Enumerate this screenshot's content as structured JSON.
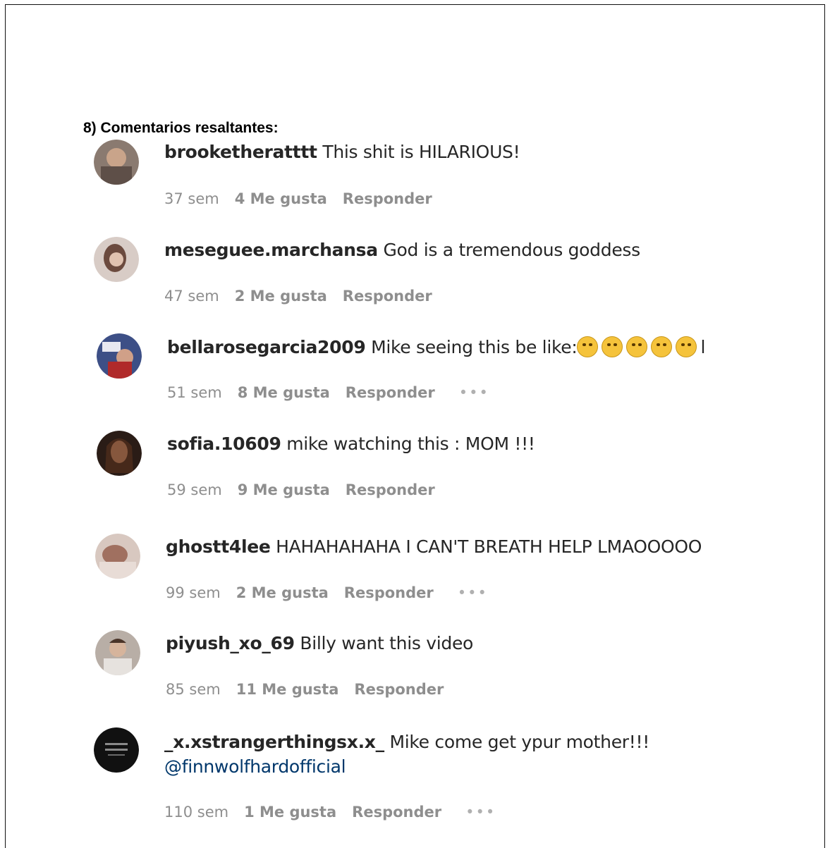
{
  "heading": "8) Comentarios resaltantes:",
  "labels": {
    "likes_suffix": "Me gusta",
    "reply": "Responder",
    "more": "•••"
  },
  "comments": [
    {
      "user": "brooketheratttt",
      "text": " This shit is HILARIOUS!",
      "time": "37 sem",
      "likes": "4 Me gusta",
      "more": false,
      "avatar_color": "#8a7a70"
    },
    {
      "user": "meseguee.marchansa",
      "text": " God is a tremendous goddess",
      "time": "47 sem",
      "likes": "2 Me gusta",
      "more": false,
      "avatar_color": "#a89890"
    },
    {
      "user": "bellarosegarcia2009",
      "text": " Mike seeing this be like:",
      "emojis": [
        "emoji-1",
        "emoji-2",
        "emoji-3",
        "emoji-4",
        "emoji-5"
      ],
      "text_after": "l",
      "time": "51 sem",
      "likes": "8 Me gusta",
      "more": true,
      "avatar_color": "#4a5a8a"
    },
    {
      "user": "sofia.10609",
      "text": " mike watching this : MOM !!!",
      "time": "59 sem",
      "likes": "9 Me gusta",
      "more": false,
      "avatar_color": "#3a2a22"
    },
    {
      "user": "ghostt4lee",
      "text": " HAHAHAHAHA I CAN'T BREATH HELP LMAOOOOO",
      "time": "99 sem",
      "likes": "2 Me gusta",
      "more": true,
      "avatar_color": "#b09a90"
    },
    {
      "user": "piyush_xo_69",
      "text": " Billy want this video",
      "time": "85 sem",
      "likes": "11 Me gusta",
      "more": false,
      "avatar_color": "#9a9088"
    },
    {
      "user": "_x.xstrangerthingsx.x_",
      "text": " Mike come get ypur mother!!!",
      "mention": "@finnwolfhardofficial",
      "time": "110 sem",
      "likes": "1 Me gusta",
      "more": true,
      "avatar_color": "#111111"
    }
  ]
}
